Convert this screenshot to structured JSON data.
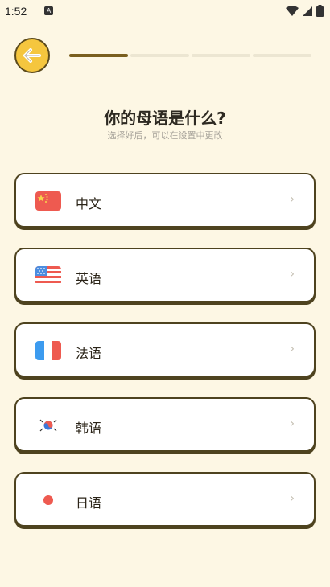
{
  "status_bar": {
    "time": "1:52",
    "app_badge": "A"
  },
  "header": {
    "progress_total": 4,
    "progress_current": 1
  },
  "title": "你的母语是什么?",
  "subtitle": "选择好后，可以在设置中更改",
  "options": [
    {
      "label": "中文",
      "flag": "china-flag-icon"
    },
    {
      "label": "英语",
      "flag": "usa-flag-icon"
    },
    {
      "label": "法语",
      "flag": "france-flag-icon"
    },
    {
      "label": "韩语",
      "flag": "korea-flag-icon"
    },
    {
      "label": "日语",
      "flag": "japan-flag-icon"
    }
  ],
  "colors": {
    "background": "#FDF7E4",
    "accent_yellow": "#F5C63E",
    "border_brown": "#4e431f",
    "progress_active": "#7A5F1F",
    "progress_inactive": "#ECE6D2"
  },
  "chevron": "›"
}
